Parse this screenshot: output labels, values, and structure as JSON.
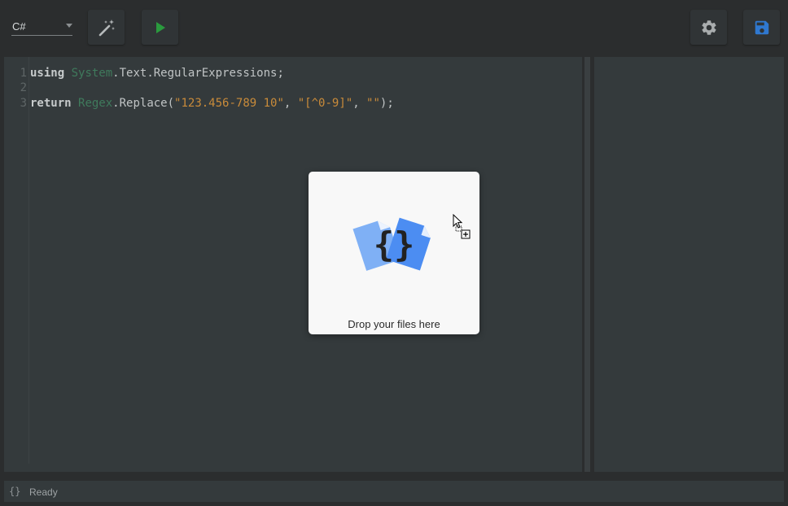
{
  "toolbar": {
    "language": "C#",
    "buttons": [
      {
        "name": "format",
        "icon": "magic-wand-icon"
      },
      {
        "name": "run",
        "icon": "play-icon"
      },
      {
        "name": "settings",
        "icon": "gear-icon"
      },
      {
        "name": "save",
        "icon": "save-icon"
      }
    ]
  },
  "editor": {
    "lines": [
      {
        "number": "1",
        "tokens": [
          {
            "type": "kw",
            "text": "using"
          },
          {
            "type": "tx",
            "text": " "
          },
          {
            "type": "ns",
            "text": "System"
          },
          {
            "type": "tx",
            "text": ".Text.RegularExpressions;"
          }
        ]
      },
      {
        "number": "2",
        "tokens": []
      },
      {
        "number": "3",
        "tokens": [
          {
            "type": "kw",
            "text": "return"
          },
          {
            "type": "tx",
            "text": " "
          },
          {
            "type": "ns",
            "text": "Regex"
          },
          {
            "type": "tx",
            "text": ".Replace("
          },
          {
            "type": "str",
            "text": "\"123.456-789 10\""
          },
          {
            "type": "tx",
            "text": ", "
          },
          {
            "type": "str",
            "text": "\"[^0-9]\""
          },
          {
            "type": "tx",
            "text": ", "
          },
          {
            "type": "str",
            "text": "\"\""
          },
          {
            "type": "tx",
            "text": ");"
          }
        ]
      }
    ]
  },
  "dropzone": {
    "label": "Drop your files here",
    "icon": "file-braces-icon"
  },
  "status": {
    "icon": "{}",
    "text": "Ready"
  },
  "colors": {
    "background": "#2b2d2e",
    "panel": "#343a3c",
    "keyword": "#c7cbcc",
    "namespace": "#3f7a5c",
    "string": "#c98b3a",
    "run_green": "#2a9a3e",
    "save_blue": "#2f78d0"
  }
}
